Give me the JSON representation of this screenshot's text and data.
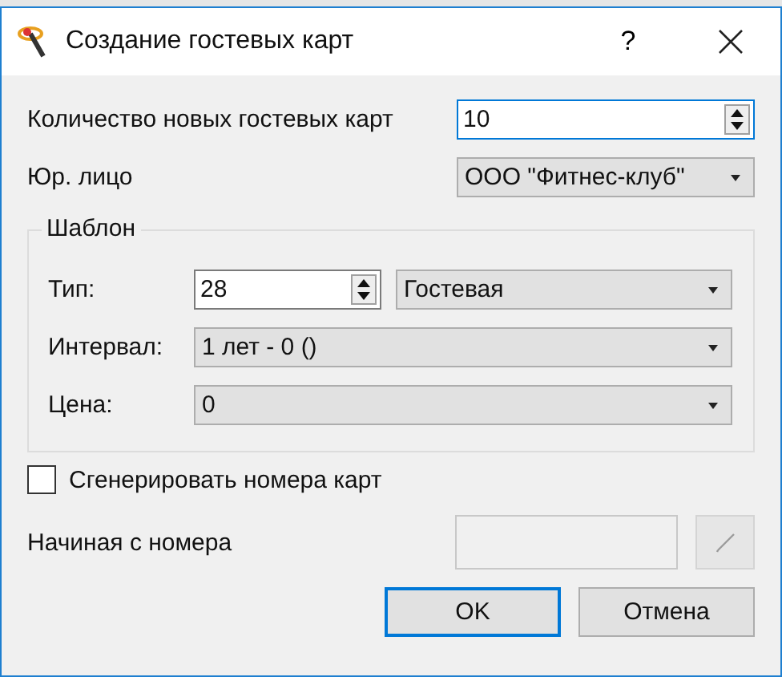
{
  "window": {
    "title": "Создание гостевых карт",
    "help": "?"
  },
  "count": {
    "label": "Количество новых гостевых карт",
    "value": "10",
    "focused": true
  },
  "legal_entity": {
    "label": "Юр. лицо",
    "value": "ООО \"Фитнес-клуб\""
  },
  "template": {
    "title": "Шаблон",
    "type": {
      "label": "Тип:",
      "value": "28",
      "choice": "Гостевая"
    },
    "interval": {
      "label": "Интервал:",
      "value": "1 лет - 0 ()"
    },
    "price": {
      "label": "Цена:",
      "value": "0"
    }
  },
  "generate": {
    "label": "Сгенерировать номера карт",
    "checked": false
  },
  "start_number": {
    "label": "Начиная с номера",
    "disabled": true
  },
  "buttons": [
    {
      "label": "OK",
      "default": true
    },
    {
      "label": "Отмена",
      "default": false
    }
  ]
}
